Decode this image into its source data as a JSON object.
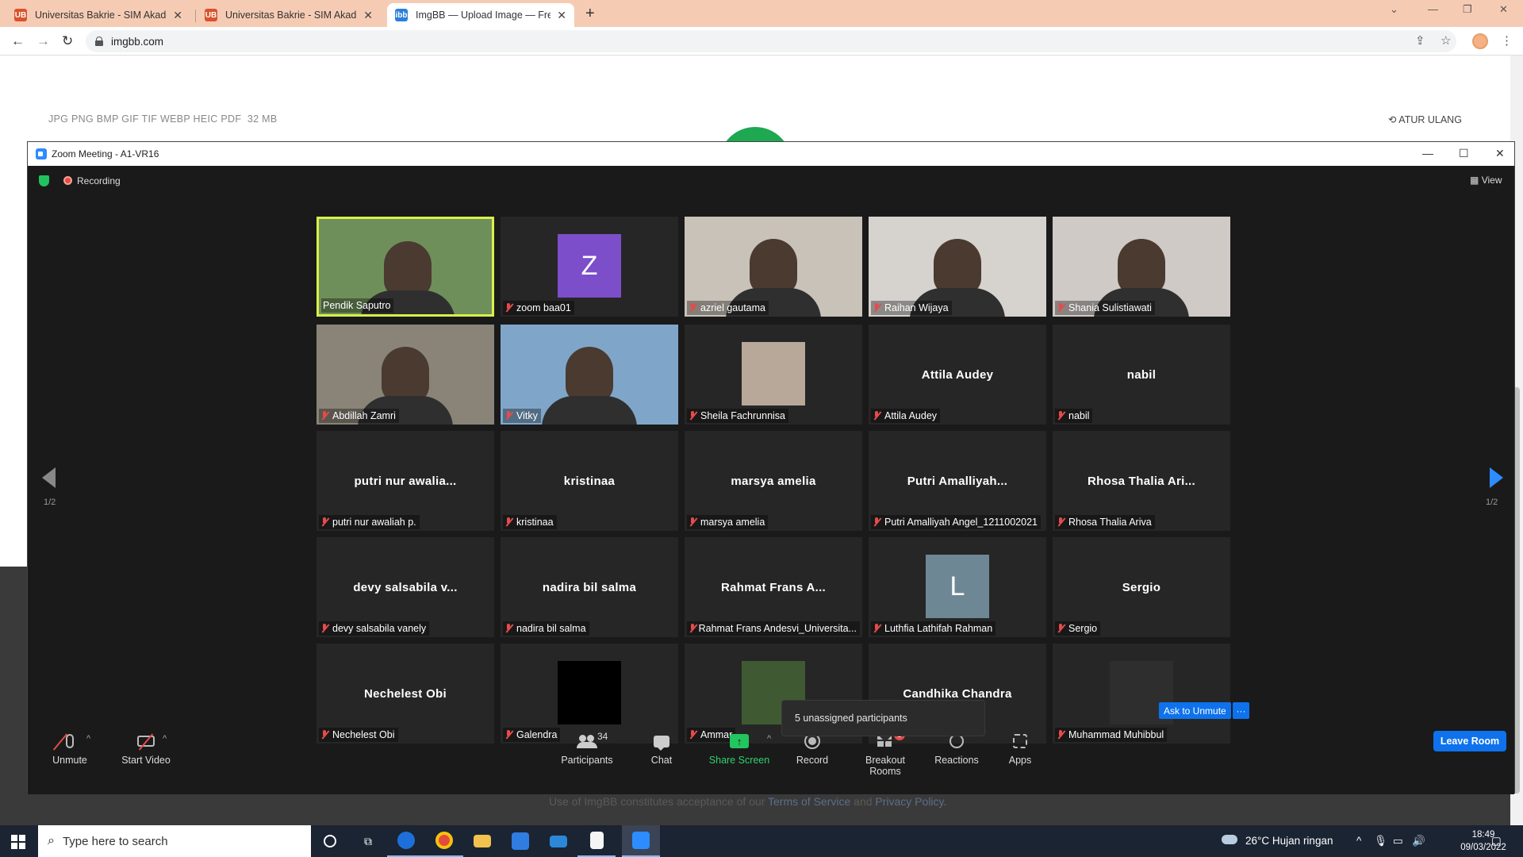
{
  "browser": {
    "tabs": [
      {
        "title": "Universitas Bakrie - SIM Akadem",
        "favicon": "UB",
        "active": false
      },
      {
        "title": "Universitas Bakrie - SIM Akadem",
        "favicon": "UB",
        "active": false
      },
      {
        "title": "ImgBB — Upload Image — Free",
        "favicon": "ibb",
        "active": true
      }
    ],
    "url": "imgbb.com"
  },
  "webpage": {
    "formats": "JPG PNG BMP GIF TIF WEBP HEIC PDF",
    "max_size": "32 MB",
    "reset_label": "ATUR ULANG",
    "footer_prefix": "Use of ImgBB constitutes acceptance of our",
    "terms": "Terms of Service",
    "and": "and",
    "privacy": "Privacy Policy."
  },
  "zoom": {
    "window_title": "Zoom Meeting - A1-VR16",
    "recording_label": "Recording",
    "view_label": "View",
    "page_left": "1/2",
    "page_right": "1/2",
    "participants": [
      {
        "label": "Pendik Saputro",
        "kind": "video",
        "active": true,
        "muted": false,
        "bg": "#6f8f5a"
      },
      {
        "label": "zoom baa01",
        "kind": "letter",
        "letter": "Z",
        "avatar_color": "#7d4ec9",
        "muted": true
      },
      {
        "label": "azriel gautama",
        "kind": "video",
        "muted": true,
        "bg": "#c9c2b8"
      },
      {
        "label": "Raihan Wijaya",
        "kind": "video",
        "muted": true,
        "bg": "#d6d3cf"
      },
      {
        "label": "Shania Sulistiawati",
        "kind": "video",
        "muted": true,
        "bg": "#cfcac6"
      },
      {
        "label": "Abdillah Zamri",
        "kind": "video",
        "muted": true,
        "bg": "#8a8478"
      },
      {
        "label": "Vitky",
        "kind": "video",
        "muted": true,
        "bg": "#7fa6c9"
      },
      {
        "label": "Sheila Fachrunnisa",
        "kind": "photo",
        "muted": true,
        "avatar_color": "#b7a89a"
      },
      {
        "label": "Attila Audey",
        "kind": "name",
        "display": "Attila Audey",
        "muted": true
      },
      {
        "label": "nabil",
        "kind": "name",
        "display": "nabil",
        "muted": true
      },
      {
        "label": "putri nur awaliah p.",
        "kind": "name",
        "display": "putri  nur  awalia...",
        "muted": true
      },
      {
        "label": "kristinaa",
        "kind": "name",
        "display": "kristinaa",
        "muted": true
      },
      {
        "label": "marsya amelia",
        "kind": "name",
        "display": "marsya amelia",
        "muted": true
      },
      {
        "label": "Putri Amalliyah Angel_1211002021",
        "kind": "name",
        "display": "Putri  Amalliyah...",
        "muted": true
      },
      {
        "label": "Rhosa Thalia Ariva",
        "kind": "name",
        "display": "Rhosa Thalia Ari...",
        "muted": true
      },
      {
        "label": "devy salsabila vanely",
        "kind": "name",
        "display": "devy  salsabila  v...",
        "muted": true
      },
      {
        "label": "nadira bil salma",
        "kind": "name",
        "display": "nadira bil salma",
        "muted": true
      },
      {
        "label": "Rahmat Frans Andesvi_Universita...",
        "kind": "name",
        "display": "Rahmat Frans A...",
        "muted": true
      },
      {
        "label": "Luthfia Lathifah Rahman",
        "kind": "letter",
        "letter": "L",
        "avatar_color": "#6e8794",
        "muted": true
      },
      {
        "label": "Sergio",
        "kind": "name",
        "display": "Sergio",
        "muted": true
      },
      {
        "label": "Nechelest Obi",
        "kind": "name",
        "display": "Nechelest Obi",
        "muted": true
      },
      {
        "label": "Galendra",
        "kind": "photo",
        "muted": true,
        "avatar_color": "#000000"
      },
      {
        "label": "Ammar",
        "kind": "photo",
        "muted": true,
        "avatar_color": "#3f5a33"
      },
      {
        "label": "",
        "kind": "name",
        "display": "Candhika Chandra",
        "muted": false
      },
      {
        "label": "Muhammad Muhibbul",
        "kind": "photo",
        "muted": true,
        "avatar_color": "#2e2e2e"
      }
    ],
    "ask_to_unmute": "Ask to Unmute",
    "more_label": "···",
    "tooltip": "5 unassigned participants",
    "controls": {
      "unmute": "Unmute",
      "start_video": "Start Video",
      "participants": "Participants",
      "participants_count": "34",
      "chat": "Chat",
      "share_screen": "Share Screen",
      "record": "Record",
      "breakout_rooms": "Breakout Rooms",
      "breakout_badge": "5",
      "reactions": "Reactions",
      "apps": "Apps",
      "leave_room": "Leave Room"
    }
  },
  "taskbar": {
    "search_placeholder": "Type here to search",
    "weather": "26°C  Hujan ringan",
    "time": "18:49",
    "date": "09/03/2022"
  },
  "colors": {
    "accent_blue": "#0e72ed",
    "share_green": "#22c55e",
    "muted_red": "#e84a4a",
    "active_speaker": "#d8f04a"
  }
}
